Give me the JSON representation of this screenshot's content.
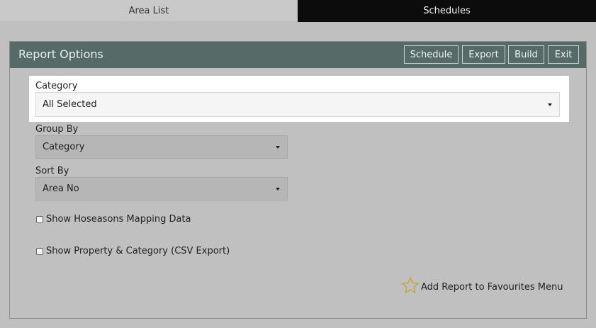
{
  "tabs": [
    {
      "label": "Area List"
    },
    {
      "label": "Schedules"
    }
  ],
  "panel": {
    "title": "Report Options",
    "buttons": {
      "schedule": "Schedule",
      "export": "Export",
      "build": "Build",
      "exit": "Exit"
    }
  },
  "fields": {
    "category": {
      "label": "Category",
      "value": "All Selected"
    },
    "group_by": {
      "label": "Group By",
      "value": "Category"
    },
    "sort_by": {
      "label": "Sort By",
      "value": "Area No"
    }
  },
  "checkboxes": {
    "hoseasons": {
      "label": "Show Hoseasons Mapping Data",
      "checked": false
    },
    "property_category": {
      "label": "Show Property & Category (CSV Export)",
      "checked": false
    }
  },
  "favourites": {
    "label": "Add Report to Favourites Menu",
    "icon": "star-icon"
  },
  "colors": {
    "header_bg": "#566b67",
    "page_bg": "#c0c0c0",
    "active_tab_bg": "#0c0c0c",
    "star": "#c9a227"
  }
}
